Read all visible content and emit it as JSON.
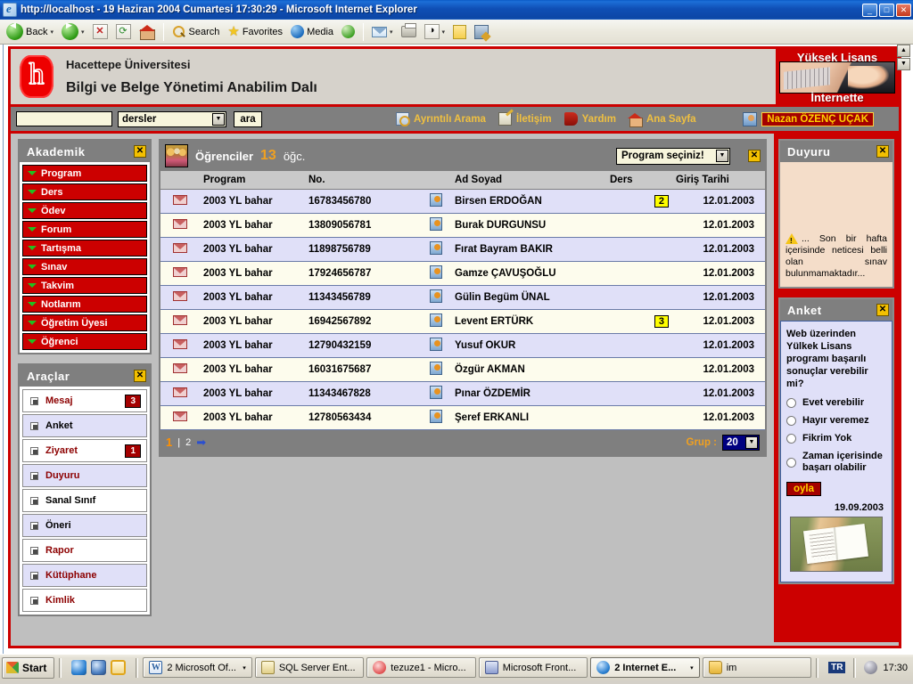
{
  "window": {
    "title": "http://localhost - 19 Haziran 2004 Cumartesi 17:30:29 - Microsoft Internet Explorer",
    "minimize": "_",
    "maximize": "□",
    "close": "✕"
  },
  "ie_toolbar": {
    "back": "Back",
    "search": "Search",
    "favorites": "Favorites",
    "media": "Media"
  },
  "site_header": {
    "line1": "Hacettepe Üniversitesi",
    "line2": "Bilgi ve Belge Yönetimi Anabilim Dalı",
    "banner_line1": "Yüksek Lisans",
    "banner_line2": "İnternette"
  },
  "nav": {
    "search_value": "",
    "search_placeholder": "",
    "scope_selected": "dersler",
    "search_button": "ara",
    "links": [
      {
        "label": "Ayrıntılı Arama",
        "icon": "detailed-search-icon"
      },
      {
        "label": "İletişim",
        "icon": "contact-pen-icon"
      },
      {
        "label": "Yardım",
        "icon": "help-book-icon"
      },
      {
        "label": "Ana Sayfa",
        "icon": "home-icon"
      }
    ],
    "user_name": "Nazan ÖZENÇ UÇAK",
    "scroll_up": "▲",
    "scroll_down": "▼"
  },
  "akademik": {
    "title": "Akademik",
    "close": "✕",
    "items": [
      {
        "label": "Program"
      },
      {
        "label": "Ders"
      },
      {
        "label": "Ödev"
      },
      {
        "label": "Forum"
      },
      {
        "label": "Tartışma"
      },
      {
        "label": "Sınav"
      },
      {
        "label": "Takvim"
      },
      {
        "label": "Notlarım"
      },
      {
        "label": "Öğretim Üyesi"
      },
      {
        "label": "Öğrenci"
      }
    ]
  },
  "araclar": {
    "title": "Araçlar",
    "close": "✕",
    "items": [
      {
        "label": "Mesaj",
        "badge": "3"
      },
      {
        "label": "Anket",
        "badge": ""
      },
      {
        "label": "Ziyaret",
        "badge": "1"
      },
      {
        "label": "Duyuru",
        "badge": ""
      },
      {
        "label": "Sanal Sınıf",
        "badge": ""
      },
      {
        "label": "Öneri",
        "badge": ""
      },
      {
        "label": "Rapor",
        "badge": ""
      },
      {
        "label": "Kütüphane",
        "badge": ""
      },
      {
        "label": "Kimlik",
        "badge": ""
      }
    ]
  },
  "students_panel": {
    "title": "Öğrenciler",
    "count": "13",
    "count_unit": "öğc.",
    "program_select": "Program seçiniz!",
    "close": "✕",
    "columns": [
      "Program",
      "No.",
      "Ad Soyad",
      "Ders",
      "Giriş Tarihi"
    ],
    "rows": [
      {
        "program": "2003 YL bahar",
        "no": "16783456780",
        "name": "Birsen ERDOĞAN",
        "ders": "2",
        "date": "12.01.2003"
      },
      {
        "program": "2003 YL bahar",
        "no": "13809056781",
        "name": "Burak DURGUNSU",
        "ders": "",
        "date": "12.01.2003"
      },
      {
        "program": "2003 YL bahar",
        "no": "11898756789",
        "name": "Fırat Bayram BAKIR",
        "ders": "",
        "date": "12.01.2003"
      },
      {
        "program": "2003 YL bahar",
        "no": "17924656787",
        "name": "Gamze ÇAVUŞOĞLU",
        "ders": "",
        "date": "12.01.2003"
      },
      {
        "program": "2003 YL bahar",
        "no": "11343456789",
        "name": "Gülin Begüm ÜNAL",
        "ders": "",
        "date": "12.01.2003"
      },
      {
        "program": "2003 YL bahar",
        "no": "16942567892",
        "name": "Levent ERTÜRK",
        "ders": "3",
        "date": "12.01.2003"
      },
      {
        "program": "2003 YL bahar",
        "no": "12790432159",
        "name": "Yusuf OKUR",
        "ders": "",
        "date": "12.01.2003"
      },
      {
        "program": "2003 YL bahar",
        "no": "16031675687",
        "name": "Özgür AKMAN",
        "ders": "",
        "date": "12.01.2003"
      },
      {
        "program": "2003 YL bahar",
        "no": "11343467828",
        "name": "Pınar ÖZDEMİR",
        "ders": "",
        "date": "12.01.2003"
      },
      {
        "program": "2003 YL bahar",
        "no": "12780563434",
        "name": "Şeref ERKANLI",
        "ders": "",
        "date": "12.01.2003"
      }
    ],
    "pagination": {
      "current": "1",
      "separator": "|",
      "next_page": "2",
      "next_arrow": "➡"
    },
    "group_label": "Grup :",
    "group_value": "20"
  },
  "duyuru": {
    "title": "Duyuru",
    "close": "✕",
    "text": "... Son bir hafta içerisinde neticesi belli olan sınav bulunmamaktadır..."
  },
  "anket": {
    "title": "Anket",
    "close": "✕",
    "question": "Web üzerinden Yülkek Lisans programı başarılı sonuçlar verebilir mi?",
    "options": [
      "Evet verebilir",
      "Hayır veremez",
      "Fikrim Yok",
      "Zaman içerisinde başarı olabilir"
    ],
    "vote_button": "oyla",
    "date": "19.09.2003"
  },
  "taskbar": {
    "start": "Start",
    "tasks": [
      {
        "label": "2 Microsoft Of...",
        "icon": "word-icon",
        "caret": "▾",
        "active": false
      },
      {
        "label": "SQL Server Ent...",
        "icon": "sql-icon",
        "caret": "",
        "active": false
      },
      {
        "label": "tezuze1 - Micro...",
        "icon": "tez-icon",
        "caret": "",
        "active": false
      },
      {
        "label": "Microsoft Front...",
        "icon": "frontpage-icon",
        "caret": "",
        "active": false
      },
      {
        "label": "2 Internet E...",
        "icon": "ie-icon",
        "caret": "▾",
        "active": true
      },
      {
        "label": "im",
        "icon": "folder-icon",
        "caret": "",
        "active": false
      }
    ],
    "lang": "TR",
    "time": "17:30"
  }
}
